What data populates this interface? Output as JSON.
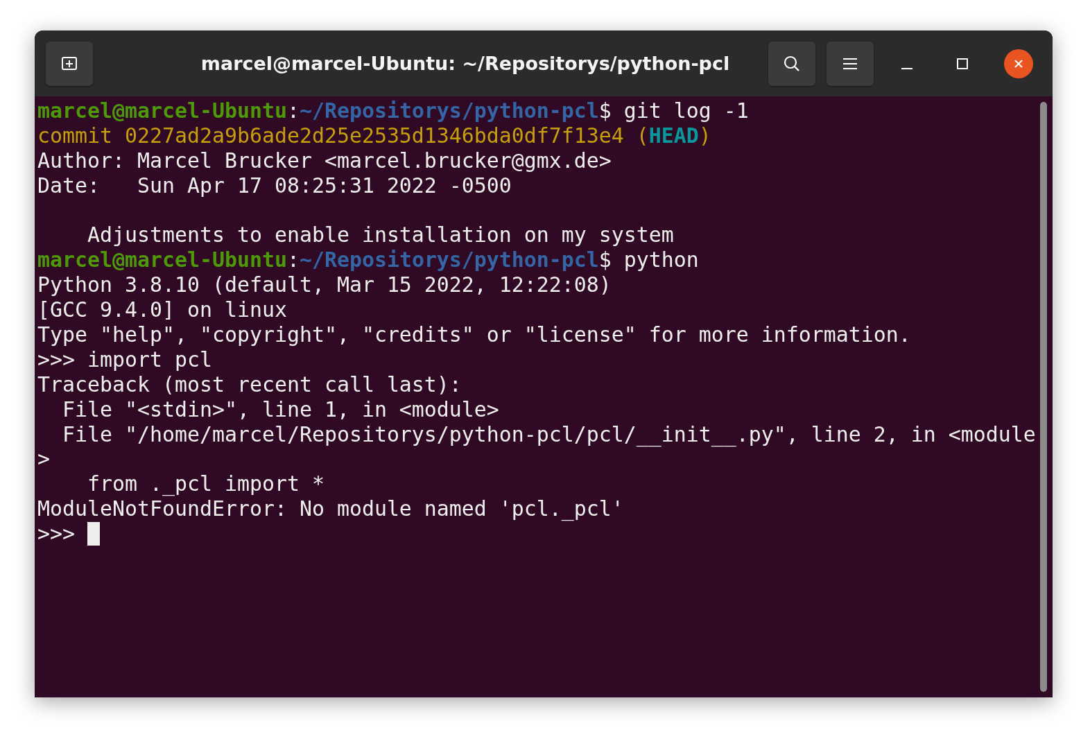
{
  "window": {
    "title": "marcel@marcel-Ubuntu: ~/Repositorys/python-pcl"
  },
  "header_buttons": [
    {
      "kind": "new-tab"
    },
    {
      "kind": "search"
    },
    {
      "kind": "menu"
    },
    {
      "kind": "minimize"
    },
    {
      "kind": "maximize"
    },
    {
      "kind": "close"
    }
  ],
  "terminal": {
    "lines": [
      {
        "kind": "text",
        "segments": [
          {
            "kind": "user",
            "text": "marcel@marcel-Ubuntu"
          },
          {
            "kind": "plain",
            "text": ":"
          },
          {
            "kind": "path",
            "text": "~/Repositorys/python-pcl"
          },
          {
            "kind": "plain",
            "text": "$ git log -1"
          }
        ]
      },
      {
        "kind": "text",
        "segments": [
          {
            "kind": "commit",
            "text": "commit 0227ad2a9b6ade2d25e2535d1346bda0df7f13e4 ("
          },
          {
            "kind": "ref",
            "text": "HEAD"
          },
          {
            "kind": "commit",
            "text": ")"
          }
        ]
      },
      {
        "kind": "text",
        "segments": [
          {
            "kind": "plain",
            "text": "Author: Marcel Brucker <marcel.brucker@gmx.de>"
          }
        ]
      },
      {
        "kind": "text",
        "segments": [
          {
            "kind": "plain",
            "text": "Date:   Sun Apr 17 08:25:31 2022 -0500"
          }
        ]
      },
      {
        "kind": "blank"
      },
      {
        "kind": "text",
        "segments": [
          {
            "kind": "plain",
            "text": "    Adjustments to enable installation on my system"
          }
        ]
      },
      {
        "kind": "text",
        "segments": [
          {
            "kind": "user",
            "text": "marcel@marcel-Ubuntu"
          },
          {
            "kind": "plain",
            "text": ":"
          },
          {
            "kind": "path",
            "text": "~/Repositorys/python-pcl"
          },
          {
            "kind": "plain",
            "text": "$ python"
          }
        ]
      },
      {
        "kind": "text",
        "segments": [
          {
            "kind": "plain",
            "text": "Python 3.8.10 (default, Mar 15 2022, 12:22:08)"
          }
        ]
      },
      {
        "kind": "text",
        "segments": [
          {
            "kind": "plain",
            "text": "[GCC 9.4.0] on linux"
          }
        ]
      },
      {
        "kind": "text",
        "segments": [
          {
            "kind": "plain",
            "text": "Type \"help\", \"copyright\", \"credits\" or \"license\" for more information."
          }
        ]
      },
      {
        "kind": "text",
        "segments": [
          {
            "kind": "plain",
            "text": ">>> import pcl"
          }
        ]
      },
      {
        "kind": "text",
        "segments": [
          {
            "kind": "plain",
            "text": "Traceback (most recent call last):"
          }
        ]
      },
      {
        "kind": "text",
        "segments": [
          {
            "kind": "plain",
            "text": "  File \"<stdin>\", line 1, in <module>"
          }
        ]
      },
      {
        "kind": "text",
        "segments": [
          {
            "kind": "plain",
            "text": "  File \"/home/marcel/Repositorys/python-pcl/pcl/__init__.py\", line 2, in <module"
          }
        ]
      },
      {
        "kind": "text",
        "segments": [
          {
            "kind": "plain",
            "text": ">"
          }
        ]
      },
      {
        "kind": "text",
        "segments": [
          {
            "kind": "plain",
            "text": "    from ._pcl import *"
          }
        ]
      },
      {
        "kind": "text",
        "segments": [
          {
            "kind": "plain",
            "text": "ModuleNotFoundError: No module named 'pcl._pcl'"
          }
        ]
      },
      {
        "kind": "text",
        "segments": [
          {
            "kind": "plain",
            "text": ">>> "
          }
        ],
        "cursor": true
      }
    ]
  }
}
